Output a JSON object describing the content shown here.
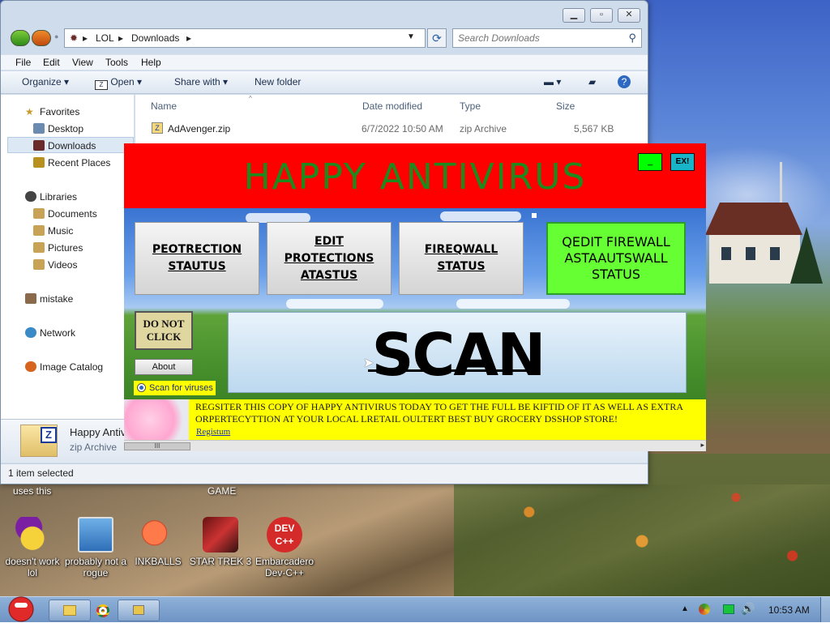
{
  "explorer": {
    "breadcrumb": [
      "LOL",
      "Downloads"
    ],
    "search_placeholder": "Search Downloads",
    "menu": [
      "File",
      "Edit",
      "View",
      "Tools",
      "Help"
    ],
    "toolbar": {
      "organize": "Organize",
      "open": "Open",
      "share_with": "Share with",
      "new_folder": "New folder"
    },
    "nav": {
      "favorites": "Favorites",
      "desktop": "Desktop",
      "downloads": "Downloads",
      "recent_places": "Recent Places",
      "libraries": "Libraries",
      "documents": "Documents",
      "music": "Music",
      "pictures": "Pictures",
      "videos": "Videos",
      "mistake": "mistake",
      "network": "Network",
      "image_catalog": "Image Catalog"
    },
    "columns": {
      "name": "Name",
      "date": "Date modified",
      "type": "Type",
      "size": "Size"
    },
    "files": [
      {
        "name": "AdAvenger.zip",
        "date": "6/7/2022 10:50 AM",
        "type": "zip Archive",
        "size": "5,567 KB"
      }
    ],
    "detail": {
      "name": "Happy Antiv",
      "type": "zip Archive"
    },
    "status": "1 item selected"
  },
  "antivirus": {
    "title": "HAPPY ANTIVIRUS",
    "minimize": "_",
    "close": "EX!",
    "buttons": [
      {
        "label": "PEOTRECTION STAUTUS"
      },
      {
        "label": "EDIT PROTECTIONS ATASTUS"
      },
      {
        "label": "FIREQWALL STATUS"
      },
      {
        "label": "QEDIT FIREWALL ASTAAUTSWALL STATUS"
      }
    ],
    "do_not_click": "DO NOT CLICK",
    "about": "About",
    "scan_option": "Scan for viruses",
    "scan": "SCAN",
    "banner": "REGSITER THIS COPY OF HAPPY ANTIVIRUS TODAY TO GET THE FULL BE KIFTID OF IT AS WELL AS EXTRA ORPERTECYTTION AT YOUR LOCAL LRETAIL OULTERT BEST BUY GROCERY DSSHOP STORE!",
    "register": "Registum",
    "scroll_thumb": "III"
  },
  "desktop_icons": {
    "top_labels": [
      "uses this",
      "GAME"
    ],
    "icons": [
      {
        "label": "doesn't work lol"
      },
      {
        "label": "probably not a rogue"
      },
      {
        "label": "INKBALLS"
      },
      {
        "label": "STAR TREK 3"
      },
      {
        "label": "Embarcadero Dev-C++"
      }
    ],
    "devcpp_logo": "DEV C++"
  },
  "taskbar": {
    "clock": "10:53 AM"
  },
  "colors": {
    "av_header": "#ff0000",
    "av_title": "#1e8a1e",
    "av_green_button": "#66ff33",
    "banner": "#ffff00"
  }
}
